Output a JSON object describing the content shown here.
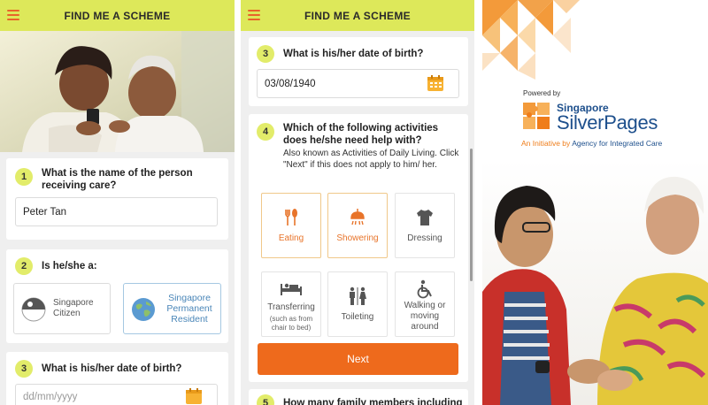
{
  "header": {
    "title": "FIND ME A SCHEME"
  },
  "q1": {
    "number": "1",
    "question": "What is the name of the person receiving care?",
    "value": "Peter Tan"
  },
  "q2": {
    "number": "2",
    "question": "Is he/she a:",
    "options": [
      {
        "label": "Singapore Citizen",
        "icon": "singapore-flag-icon",
        "selected": false
      },
      {
        "label": "Singapore Permanent Resident",
        "icon": "globe-icon",
        "selected": true
      }
    ]
  },
  "q3": {
    "number": "3",
    "question": "What is his/her date of birth?",
    "placeholder": "dd/mm/yyyy",
    "value": "03/08/1940"
  },
  "q4": {
    "number": "4",
    "question": "Which of the following activities does he/she need help with?",
    "hint": "Also known as Activities of Daily Living. Click \"Next\" if this does not apply to him/ her.",
    "activities": [
      {
        "label": "Eating",
        "icon": "cutlery-icon",
        "selected": true
      },
      {
        "label": "Showering",
        "icon": "shower-icon",
        "selected": true
      },
      {
        "label": "Dressing",
        "icon": "shirt-icon",
        "selected": false
      },
      {
        "label": "Transferring",
        "sublabel": "(such as from chair to bed)",
        "icon": "bed-transfer-icon",
        "selected": false
      },
      {
        "label": "Toileting",
        "icon": "toilet-icon",
        "selected": false
      },
      {
        "label": "Walking or moving around",
        "icon": "wheelchair-icon",
        "selected": false
      }
    ],
    "next_label": "Next"
  },
  "q5": {
    "number": "5",
    "question_fragment": "How many family members including"
  },
  "brand": {
    "powered_by": "Powered by",
    "name_prefix": "Singapore",
    "name_main": "SilverPages",
    "tagline_prefix": "An Initiative by",
    "tagline_org": "Agency for Integrated Care"
  },
  "colors": {
    "topbar": "#dde85a",
    "accent_orange": "#ee6a1c",
    "selected_blue": "#4a86b8",
    "brand_blue": "#1d4f8c"
  }
}
